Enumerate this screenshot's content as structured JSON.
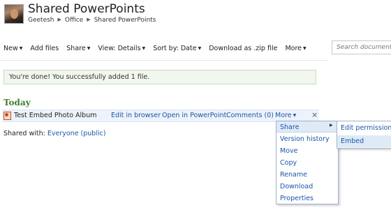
{
  "header": {
    "title": "Shared PowerPoints",
    "breadcrumb": [
      "Geetesh",
      "Office",
      "Shared PowerPoints"
    ]
  },
  "toolbar": {
    "new": "New",
    "add_files": "Add files",
    "share": "Share",
    "view": "View: Details",
    "sort": "Sort by: Date",
    "download_zip": "Download as .zip file",
    "more": "More"
  },
  "search": {
    "placeholder": "Search documents"
  },
  "message": "You're done! You successfully added 1 file.",
  "section": "Today",
  "file": {
    "name": "Test Embed Photo Album",
    "actions": {
      "edit_in_browser": "Edit in browser",
      "open_in_app": "Open in PowerPoint",
      "comments": "Comments (0)",
      "more": "More"
    },
    "close": "×"
  },
  "shared_with": {
    "label": "Shared with:",
    "value": "Everyone (public)"
  },
  "menu": {
    "items": [
      "Share",
      "Version history",
      "Move",
      "Copy",
      "Rename",
      "Download",
      "Properties"
    ]
  },
  "submenu": {
    "items": [
      "Edit permissions",
      "Embed"
    ]
  },
  "colors": {
    "link": "#1a56a8",
    "section_heading": "#3e7e2b",
    "highlight": "#dfeaf7"
  },
  "icons": [
    "powerpoint-file-icon",
    "chevron-down-icon",
    "chevron-right-icon",
    "close-icon"
  ]
}
